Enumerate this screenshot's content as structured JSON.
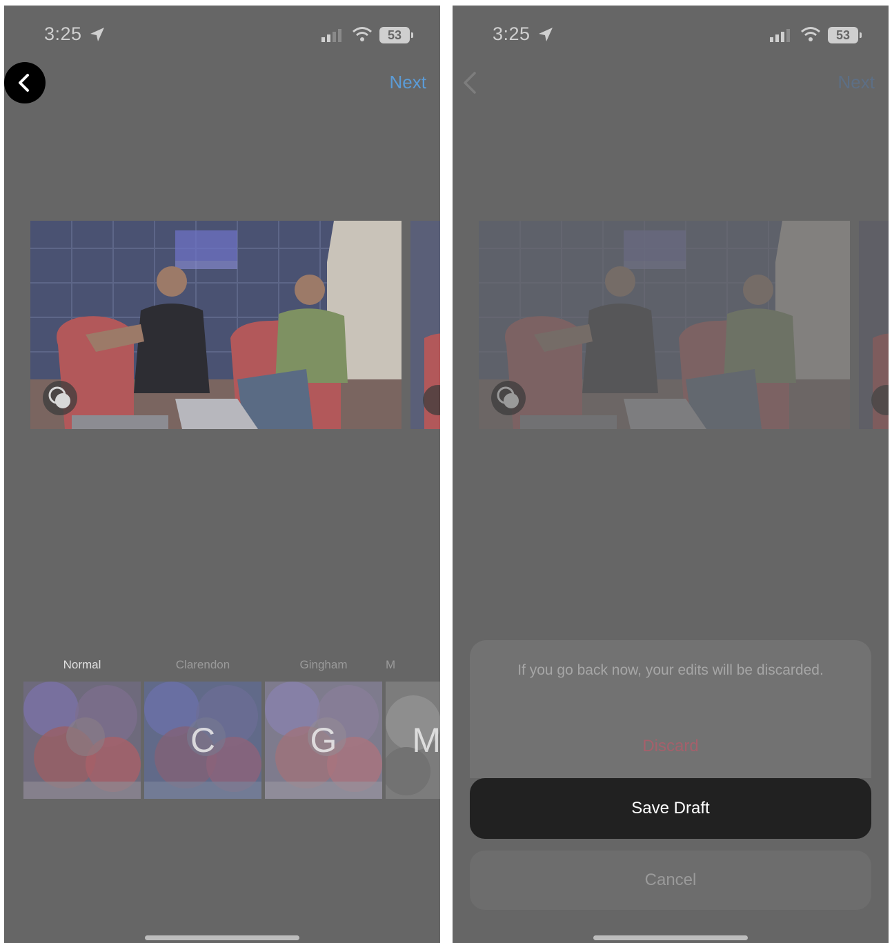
{
  "status_bar": {
    "time": "3:25",
    "battery": "53"
  },
  "left_screen": {
    "next_label": "Next",
    "filters": [
      {
        "label": "Normal",
        "letter": ""
      },
      {
        "label": "Clarendon",
        "letter": "C"
      },
      {
        "label": "Gingham",
        "letter": "G"
      },
      {
        "label": "M",
        "letter": "M"
      }
    ]
  },
  "right_screen": {
    "next_label": "Next",
    "sheet": {
      "message": "If you go back now, your edits will be discarded.",
      "discard_label": "Discard",
      "save_draft_label": "Save Draft",
      "cancel_label": "Cancel"
    }
  },
  "icons": [
    "location-arrow-icon",
    "signal-icon",
    "wifi-icon",
    "battery-icon",
    "chevron-left-icon",
    "multi-select-icon"
  ],
  "colors": {
    "accent": "#5b9bd6",
    "destructive": "#a5606b",
    "primary_button": "#212121",
    "background": "#666666"
  }
}
